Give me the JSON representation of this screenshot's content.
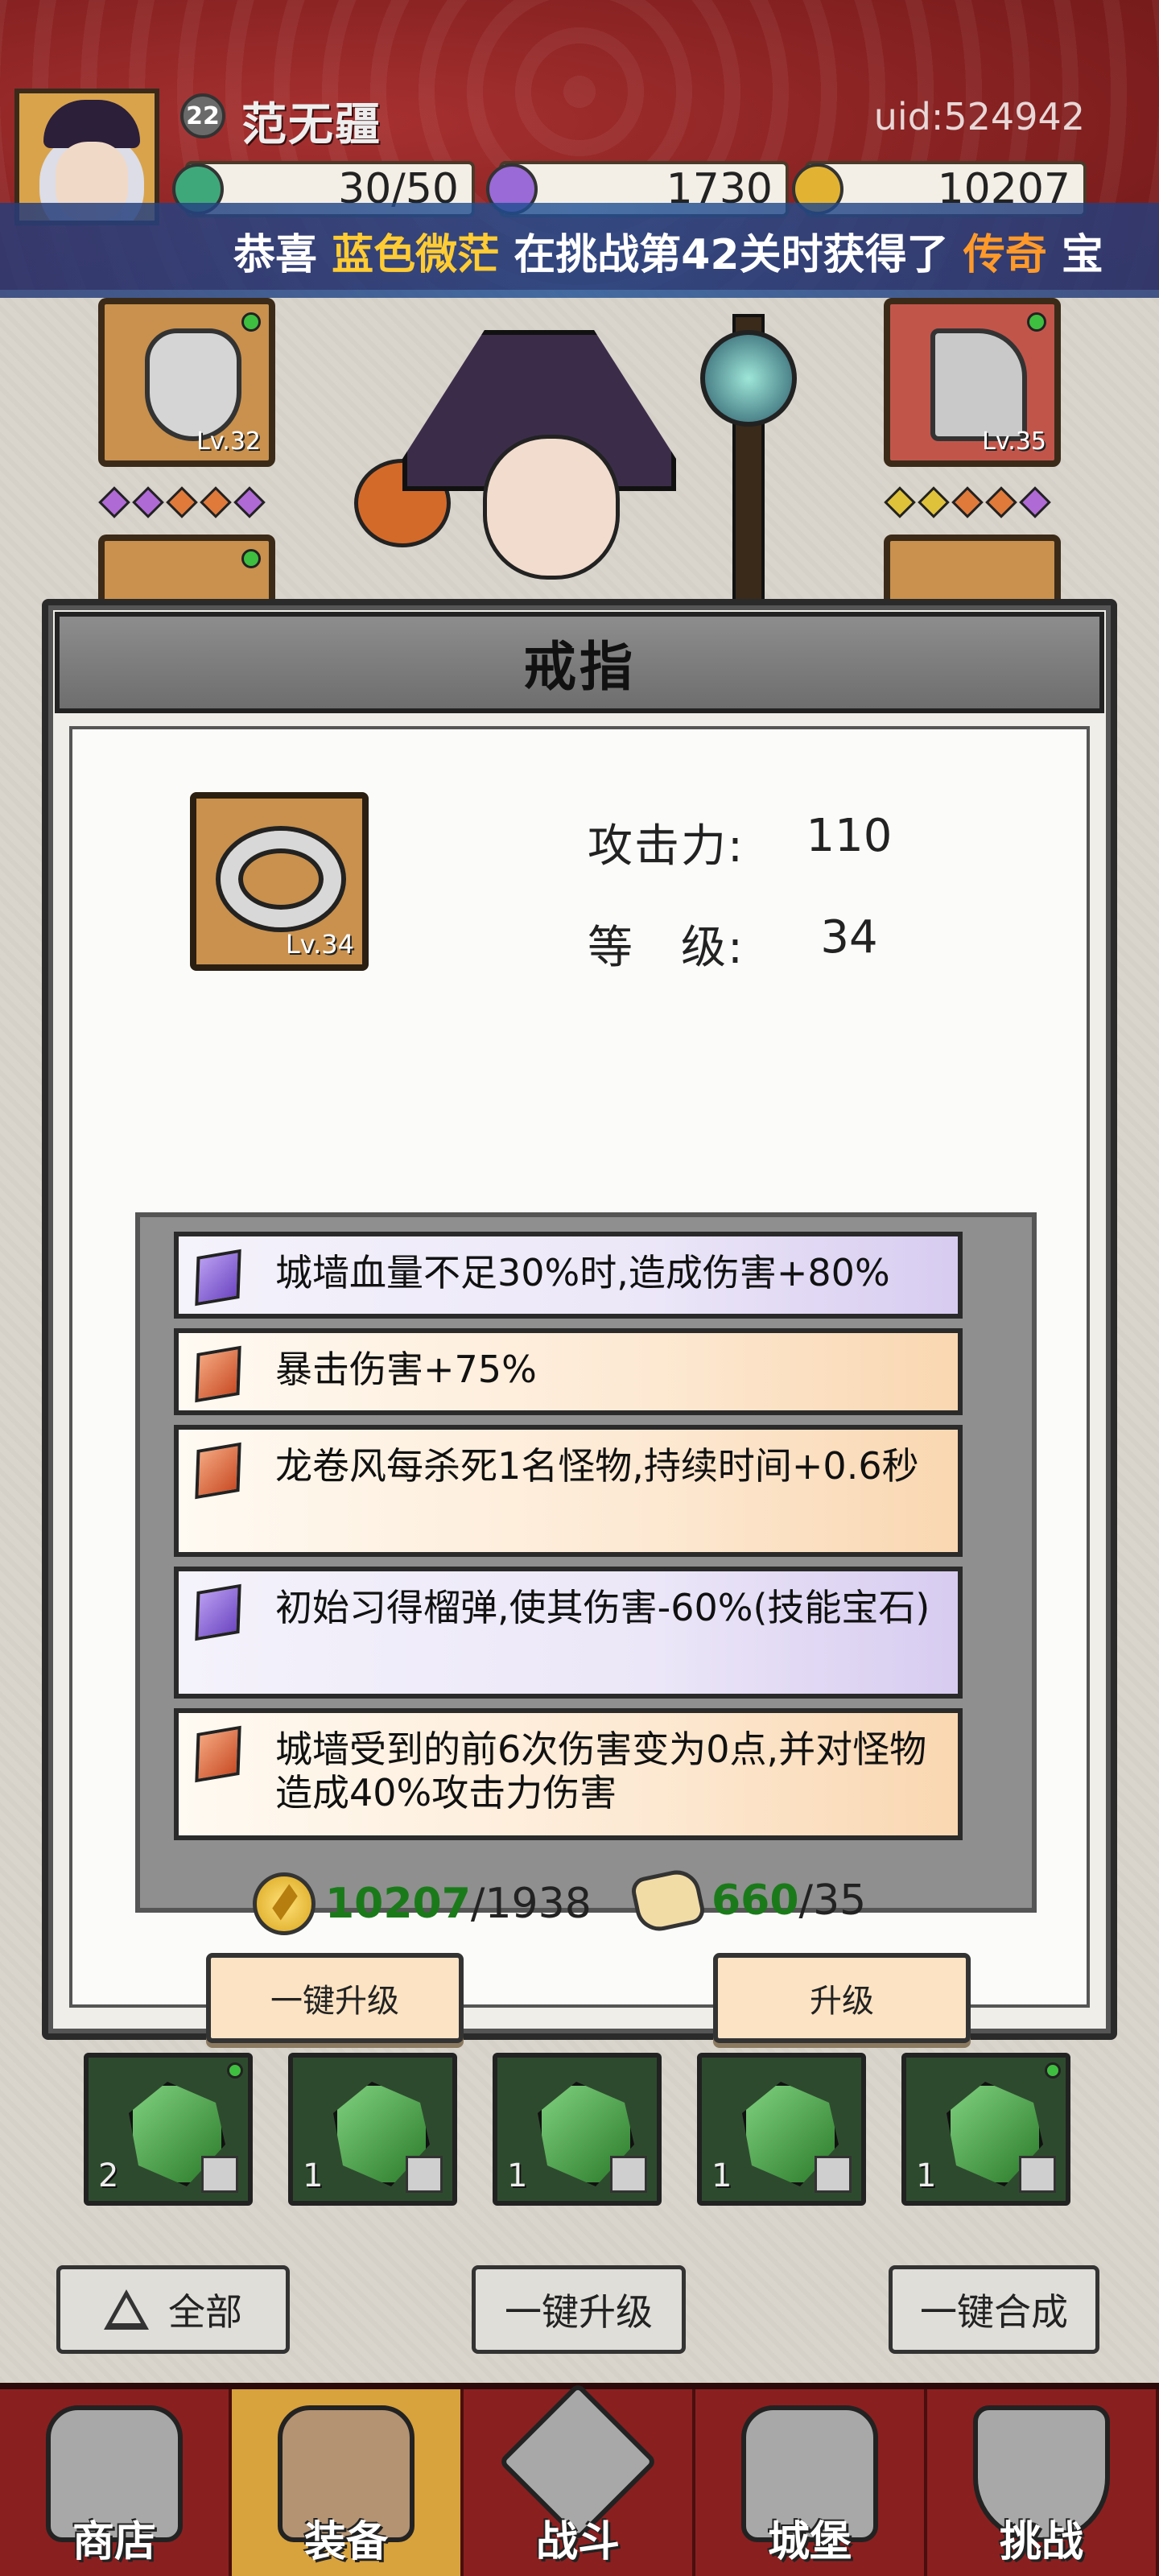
{
  "header": {
    "player_level": "22",
    "player_name": "范无疆",
    "uid": "uid:524942",
    "resources": [
      {
        "name": "energy",
        "value": "30/50",
        "icon": "green-gem-icon"
      },
      {
        "name": "diamonds",
        "value": "1730",
        "icon": "purple-diamond-icon"
      },
      {
        "name": "gold",
        "value": "10207",
        "icon": "gold-coin-icon"
      }
    ]
  },
  "marquee": {
    "prefix": "恭喜",
    "player": "蓝色微茫",
    "middle": "在挑战第42关时获得了",
    "rarity": "传奇",
    "suffix": "宝"
  },
  "equipment": {
    "slots": [
      {
        "name": "helmet",
        "level": "Lv.32",
        "icon": "helmet-icon"
      },
      {
        "name": "weapon",
        "level": "Lv.35",
        "icon": "weapon-icon"
      }
    ]
  },
  "modal": {
    "title": "戒指",
    "item_level": "Lv.34",
    "stats": [
      {
        "label": "攻击力:",
        "value": "110"
      },
      {
        "label": "等　级:",
        "value": "34"
      }
    ],
    "affixes": [
      {
        "rarity": "purple",
        "text": "城墙血量不足30%时,造成伤害+80%"
      },
      {
        "rarity": "orange",
        "text": "暴击伤害+75%"
      },
      {
        "rarity": "orange",
        "text": "龙卷风每杀死1名怪物,持续时间+0.6秒"
      },
      {
        "rarity": "purple",
        "text": "初始习得榴弹,使其伤害-60%(技能宝石)"
      },
      {
        "rarity": "orange",
        "text": "城墙受到的前6次伤害变为0点,并对怪物造成40%攻击力伤害"
      }
    ],
    "cost_gold_have": "10207",
    "cost_gold_need": "/1938",
    "cost_scroll_have": "660",
    "cost_scroll_need": "/35",
    "btn_upgrade_all": "一键升级",
    "btn_upgrade": "升级"
  },
  "inventory": [
    {
      "count": "2",
      "icon": "green-crystal-icon"
    },
    {
      "count": "1",
      "icon": "green-crystal-icon"
    },
    {
      "count": "1",
      "icon": "green-crystal-icon"
    },
    {
      "count": "1",
      "icon": "green-crystal-icon"
    },
    {
      "count": "1",
      "icon": "green-crystal-icon"
    }
  ],
  "actions": {
    "all": "全部",
    "upgrade_all": "一键升级",
    "merge_all": "一键合成"
  },
  "nav": [
    {
      "label": "商店",
      "icon": "shop-icon"
    },
    {
      "label": "装备",
      "icon": "backpack-icon"
    },
    {
      "label": "战斗",
      "icon": "crossed-swords-icon"
    },
    {
      "label": "城堡",
      "icon": "castle-icon"
    },
    {
      "label": "挑战",
      "icon": "shield-icon"
    }
  ],
  "colors": {
    "header_red": "#8a2323",
    "highlight_blue_name": "#ffcc33",
    "highlight_legend": "#ff9a2a",
    "active_tab": "#d8a23c"
  }
}
